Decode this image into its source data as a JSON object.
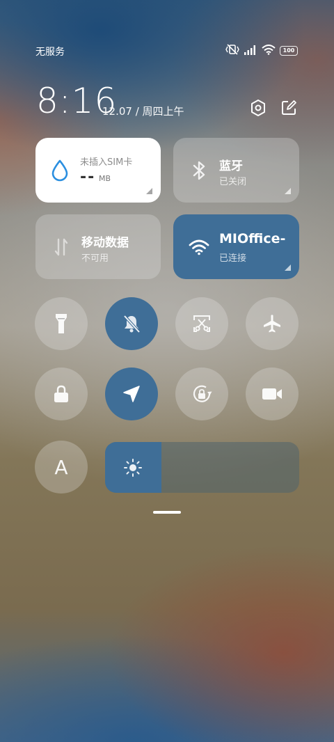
{
  "status_bar": {
    "carrier": "无服务",
    "battery": "100"
  },
  "header": {
    "time": "8:16",
    "date": "12.07 / 周四上午"
  },
  "tiles": {
    "sim": {
      "label": "未插入SIM卡",
      "value": "--",
      "unit": "MB"
    },
    "bluetooth": {
      "title": "蓝牙",
      "status": "已关闭"
    },
    "mobile_data": {
      "title": "移动数据",
      "status": "不可用"
    },
    "wifi": {
      "title": "MIOffice-",
      "status": "已连接"
    }
  },
  "toggles_row1": [
    "flashlight-icon",
    "mute-bell-icon",
    "screenshot-icon",
    "airplane-icon"
  ],
  "toggles_row2": [
    "lock-icon",
    "location-icon",
    "rotation-lock-icon",
    "video-camera-icon"
  ],
  "reading_mode": {
    "letter": "A"
  },
  "brightness": {
    "level": 0.29
  },
  "colors": {
    "accent": "#3f6e97",
    "tile_inactive": "rgba(220,220,220,0.32)",
    "water_icon": "#2b8fe0"
  }
}
